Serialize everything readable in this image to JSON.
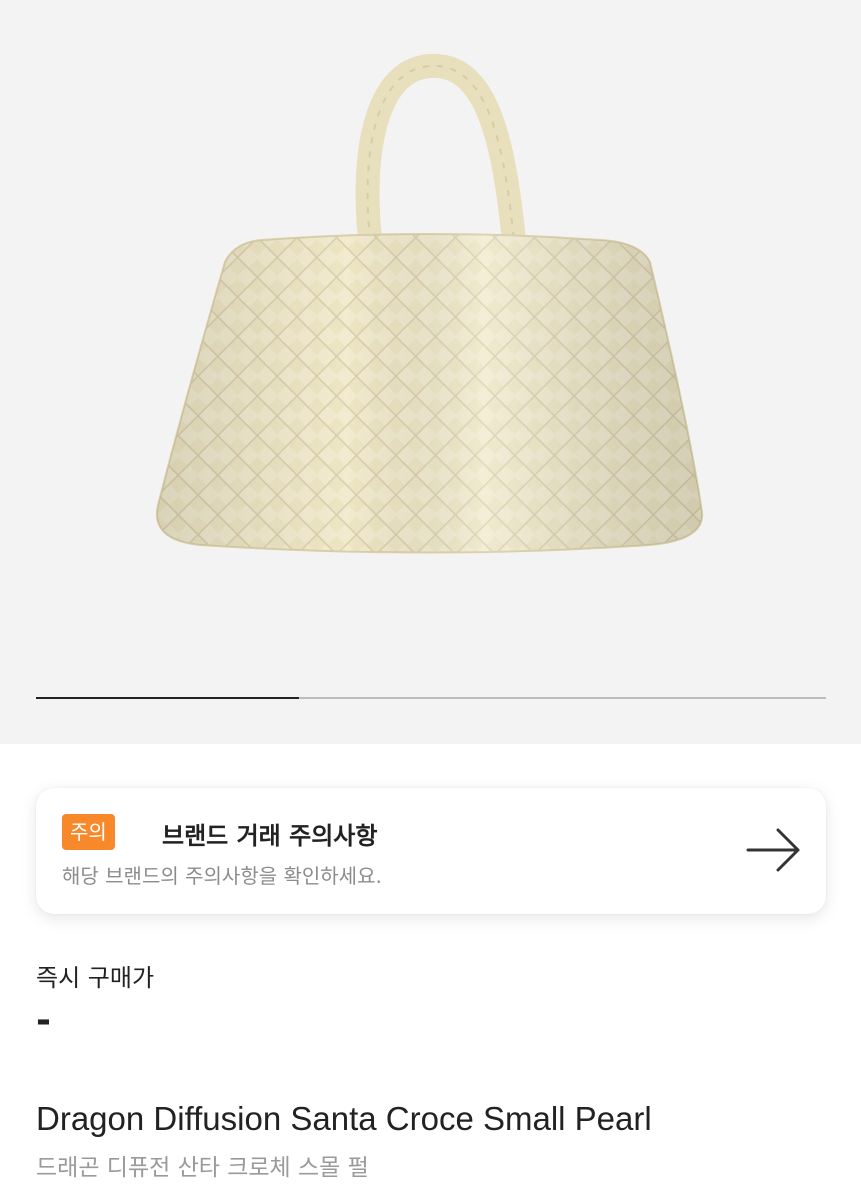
{
  "gallery": {
    "image_alt": "woven bag",
    "progress_fraction": 0.333
  },
  "notice": {
    "badge": "주의",
    "title": "브랜드 거래 주의사항",
    "description": "해당 브랜드의 주의사항을 확인하세요.",
    "arrow_icon": "arrow-right-icon",
    "badge_color": "#f7892b"
  },
  "price": {
    "label": "즉시 구매가",
    "value": "-"
  },
  "product": {
    "name_en": "Dragon Diffusion Santa Croce Small Pearl",
    "name_ko": "드래곤 디퓨전 산타 크로체 스몰 펄"
  }
}
